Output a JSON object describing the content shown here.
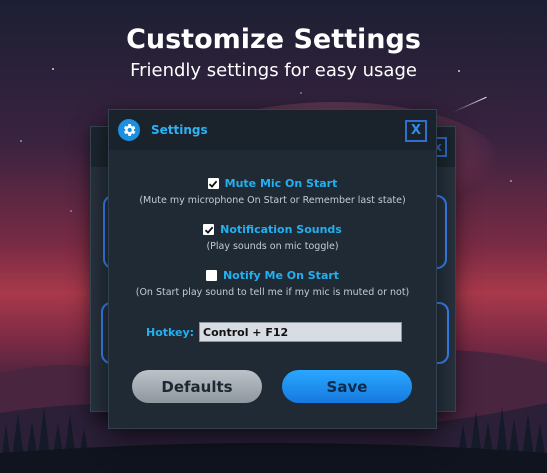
{
  "banner": {
    "title": "Customize Settings",
    "subtitle": "Friendly settings for easy usage"
  },
  "window": {
    "title": "Settings",
    "close_label": "X"
  },
  "options": [
    {
      "label": "Mute Mic On Start",
      "description": "(Mute my microphone On Start or Remember last state)",
      "checked": true
    },
    {
      "label": "Notification Sounds",
      "description": "(Play sounds on mic toggle)",
      "checked": true
    },
    {
      "label": "Notify Me On Start",
      "description": "(On Start play sound to tell me if my mic is muted or not)",
      "checked": false
    }
  ],
  "hotkey": {
    "label": "Hotkey:",
    "value": "Control + F12"
  },
  "buttons": {
    "defaults": "Defaults",
    "save": "Save"
  },
  "colors": {
    "accent": "#23b0f0",
    "save_button": "#1e8ff5",
    "window_bg": "#1f2a35"
  },
  "icons": {
    "app": "gear-icon",
    "check": "check-icon"
  }
}
